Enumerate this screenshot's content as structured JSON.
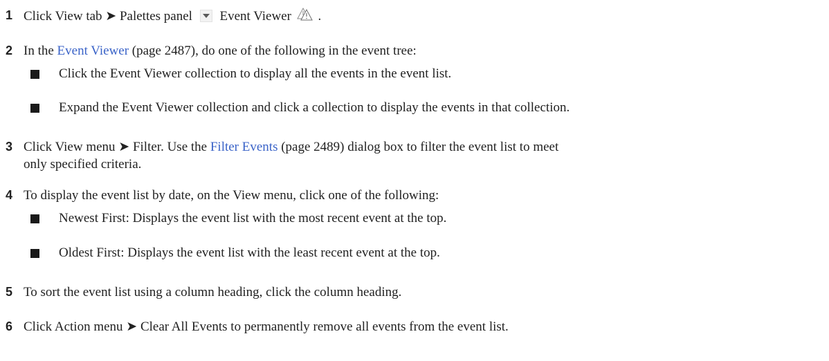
{
  "steps": [
    {
      "num": "1",
      "part1": "Click View tab ➤ Palettes panel",
      "part2": "Event Viewer",
      "part3": ".",
      "icons": [
        "dropdown-arrow-icon",
        "event-viewer-icon"
      ]
    },
    {
      "num": "2",
      "pre": "In the ",
      "link": "Event Viewer",
      "post": " (page 2487), do one of the following in the event tree:",
      "bullets": [
        "Click the Event Viewer collection to display all the events in the event list.",
        "Expand the Event Viewer collection and click a collection to display the events in that collection."
      ]
    },
    {
      "num": "3",
      "pre": "Click View menu ➤ Filter. Use the ",
      "link": "Filter Events",
      "post": " (page 2489) dialog box to filter the event list to meet",
      "line2": "only specified criteria."
    },
    {
      "num": "4",
      "text": "To display the event list by date, on the View menu, click one of the following:",
      "bullets": [
        "Newest First: Displays the event list with the most recent event at the top.",
        "Oldest First: Displays the event list with the least recent event at the top."
      ]
    },
    {
      "num": "5",
      "text": "To sort the event list using a column heading, click the column heading."
    },
    {
      "num": "6",
      "text": "Click Action menu ➤ Clear All Events to permanently remove all events from the event list."
    }
  ],
  "colors": {
    "link": "#3a63c8",
    "text": "#222222",
    "bullet": "#1a1a1a"
  }
}
